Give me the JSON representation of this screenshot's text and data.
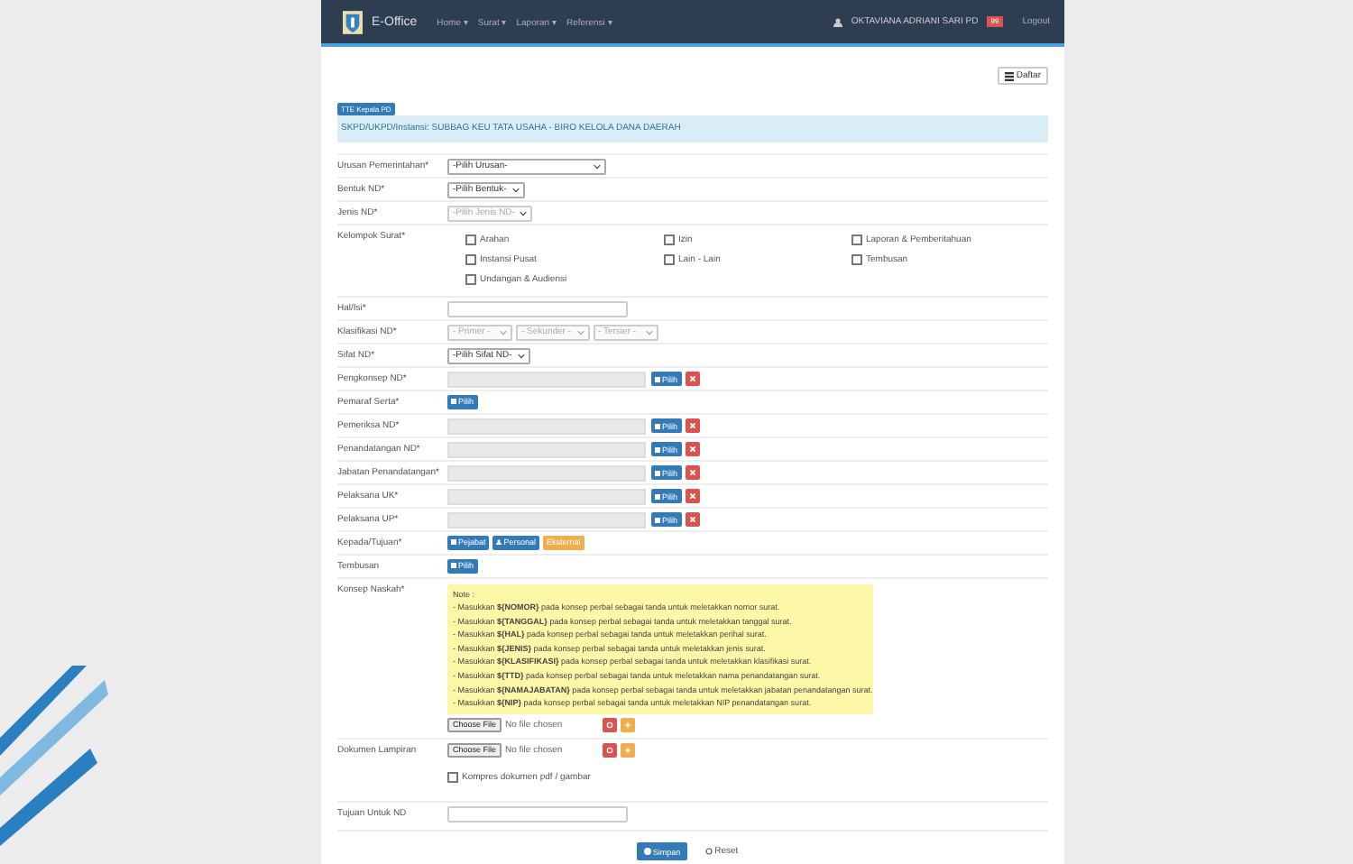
{
  "navbar": {
    "brand": "E-Office",
    "menu": [
      "Home ▾",
      "Surat ▾",
      "Laporan ▾",
      "Referensi ▾"
    ],
    "user": "OKTAVIANA ADRIANI SARI PD",
    "badge": "99",
    "logout": "Logout"
  },
  "toolbar": {
    "button": "Daftar"
  },
  "unit": {
    "badge": "TTE Kepala PD",
    "text": "SKPD/UKPD/Instansi: SUBBAG KEU TATA USAHA - BIRO KELOLA DANA DAERAH"
  },
  "fields": [
    {
      "kind": "select",
      "label": "Urusan Pemerintahan*",
      "value": "-Pilih Urusan-",
      "wide": true,
      "disabled": false
    },
    {
      "kind": "select",
      "label": "Bentuk ND*",
      "value": "-Pilih Bentuk-",
      "wide": false,
      "disabled": false
    },
    {
      "kind": "select",
      "label": "Jenis ND*",
      "value": "-Pilih Jenis ND-",
      "wide": false,
      "disabled": true
    },
    {
      "kind": "checks",
      "label": "Kelompok Surat*",
      "options": [
        {
          "label": "Arahan",
          "checked": false
        },
        {
          "label": "Izin",
          "checked": false
        },
        {
          "label": "Laporan & Pemberitahuan",
          "checked": false
        },
        {
          "label": "Instansi Pusat",
          "checked": false
        },
        {
          "label": "Lain - Lain",
          "checked": false
        },
        {
          "label": "Tembusan",
          "checked": false
        },
        {
          "label": "Undangan & Audiensi",
          "checked": false
        }
      ]
    },
    {
      "kind": "text",
      "label": "Hal/Isi*"
    },
    {
      "kind": "selects",
      "label": "Klasifikasi ND*",
      "disabled": true,
      "items": [
        "- Primer -",
        "- Sekunder -",
        "- Tersier -"
      ]
    },
    {
      "kind": "select",
      "label": "Sifat ND*",
      "value": "-Pilih Sifat ND-",
      "wide": false,
      "disabled": false
    },
    {
      "kind": "picker",
      "label": "Pengkonsep ND*",
      "button": "Pilih",
      "remove": true
    },
    {
      "kind": "picker",
      "label": "Pemaraf Serta*",
      "button": "Pilih",
      "remove": false
    },
    {
      "kind": "picker",
      "label": "Pemeriksa ND*",
      "button": "Pilih",
      "remove": true
    },
    {
      "kind": "picker",
      "label": "Penandatangan ND*",
      "button": "Pilih",
      "remove": true
    },
    {
      "kind": "picker",
      "label": "Jabatan Penandatangan*",
      "button": "Pilih",
      "remove": true
    },
    {
      "kind": "picker",
      "label": "Pelaksana UK*",
      "button": "Pilih",
      "remove": true
    },
    {
      "kind": "picker",
      "label": "Pelaksana UP*",
      "button": "Pilih",
      "remove": true
    },
    {
      "kind": "buttons",
      "label": "Kepada/Tujuan*",
      "buttons": [
        {
          "label": "Pejabat",
          "kind": "pejabat"
        },
        {
          "label": "Personal",
          "kind": "personal"
        },
        {
          "label": "Eksternal",
          "kind": "eksternal"
        }
      ]
    },
    {
      "kind": "picker",
      "label": "Tembusan",
      "button": "Pilih",
      "remove": false
    },
    {
      "kind": "note",
      "label": "Konsep Naskah*",
      "title": "Note :",
      "lines": [
        "- Masukkan **${NOMOR}** pada konsep perbal sebagai tanda untuk meletakkan nomor surat.",
        "- Masukkan **${TANGGAL}** pada konsep perbal sebagai tanda untuk meletakkan tanggal surat.",
        "- Masukkan **${HAL}** pada konsep perbal sebagai tanda untuk meletakkan perihal surat.",
        "- Masukkan **${JENIS}** pada konsep perbal sebagai tanda untuk meletakkan jenis surat.",
        "- Masukkan **${KLASIFIKASI}** pada konsep perbal sebagai tanda untuk meletakkan klasifikasi surat.",
        "- Masukkan **${TTD}** pada konsep perbal sebagai tanda untuk meletakkan nama penandatangan surat.",
        "- Masukkan **${NAMAJABATAN}** pada konsep perbal sebagai tanda untuk meletakkan jabatan penandatangan surat.",
        "- Masukkan **${NIP}** pada konsep perbal sebagai tanda untuk meletakkan NIP penandatangan surat."
      ],
      "file": {
        "button": "Choose File",
        "status": "No file chosen"
      }
    },
    {
      "kind": "file",
      "label": "Dokumen Lampiran",
      "file": {
        "button": "Choose File",
        "status": "No file chosen"
      },
      "compress": {
        "label": "Kompres dokumen pdf / gambar",
        "checked": false
      }
    },
    {
      "kind": "text",
      "label": "Tujuan Untuk ND"
    }
  ],
  "actions": {
    "submit": "Simpan",
    "reset": "Reset"
  }
}
